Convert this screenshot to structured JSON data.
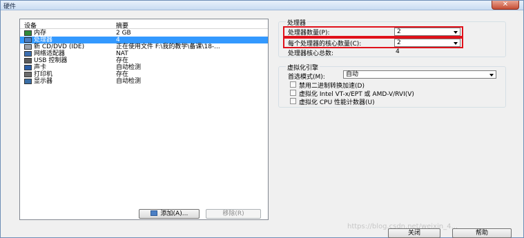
{
  "window": {
    "title": "硬件",
    "close_glyph": "✕"
  },
  "device_list": {
    "columns": {
      "device": "设备",
      "summary": "摘要"
    },
    "rows": [
      {
        "icon": "memory-icon",
        "name": "内存",
        "summary": "2 GB",
        "selected": false
      },
      {
        "icon": "processor-icon",
        "name": "处理器",
        "summary": "4",
        "selected": true
      },
      {
        "icon": "cdrom-icon",
        "name": "新 CD/DVD (IDE)",
        "summary": "正在使用文件 F:\\我的教学\\备课\\18-...",
        "selected": false
      },
      {
        "icon": "network-icon",
        "name": "网络适配器",
        "summary": "NAT",
        "selected": false
      },
      {
        "icon": "usb-icon",
        "name": "USB 控制器",
        "summary": "存在",
        "selected": false
      },
      {
        "icon": "sound-icon",
        "name": "声卡",
        "summary": "自动检测",
        "selected": false
      },
      {
        "icon": "printer-icon",
        "name": "打印机",
        "summary": "存在",
        "selected": false
      },
      {
        "icon": "display-icon",
        "name": "显示器",
        "summary": "自动检测",
        "selected": false
      }
    ],
    "add_button": "添加(A)...",
    "remove_button": "移除(R)"
  },
  "processor": {
    "group_title": "处理器",
    "count_label": "处理器数量(P):",
    "count_value": "2",
    "cores_label": "每个处理器的核心数量(C):",
    "cores_value": "2",
    "total_label": "处理器核心总数:",
    "total_value": "4"
  },
  "virtualization": {
    "group_title": "虚拟化引擎",
    "mode_label": "首选模式(M):",
    "mode_value": "自动",
    "options": [
      {
        "label": "禁用二进制转换加速(D)",
        "checked": false
      },
      {
        "label": "虚拟化 Intel VT-x/EPT 或 AMD-V/RVI(V)",
        "checked": false
      },
      {
        "label": "虚拟化 CPU 性能计数器(U)",
        "checked": false
      }
    ]
  },
  "footer": {
    "close_button": "关闭",
    "help_button": "帮助"
  },
  "watermark": "https://blog.csdn.net/weixin_4..."
}
